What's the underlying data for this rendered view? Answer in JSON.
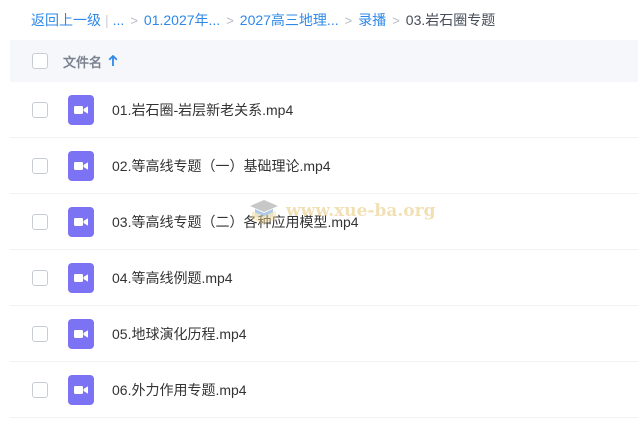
{
  "breadcrumb": {
    "back": "返回上一级",
    "ellipsis": "...",
    "items": [
      "01.2027年...",
      "2027高三地理...",
      "录播"
    ],
    "current": "03.岩石圈专题"
  },
  "table": {
    "name_header": "文件名"
  },
  "files": [
    "01.岩石圈-岩层新老关系.mp4",
    "02.等高线专题（一）基础理论.mp4",
    "03.等高线专题（二）各种应用模型.mp4",
    "04.等高线例题.mp4",
    "05.地球演化历程.mp4",
    "06.外力作用专题.mp4"
  ],
  "watermark": "www.xue-ba.org",
  "icons": {
    "file_type": "video-camera-icon",
    "sort": "arrow-up-icon"
  },
  "colors": {
    "link": "#2e88e8",
    "video_icon": "#7b73f3",
    "header_bg": "#f5f7fa"
  }
}
